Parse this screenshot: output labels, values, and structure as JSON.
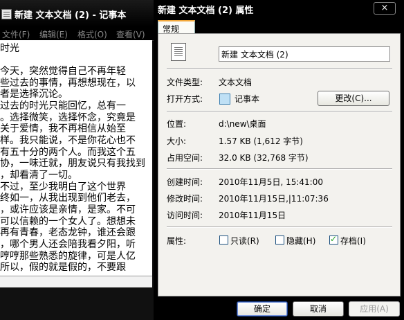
{
  "notepad": {
    "title": "新建 文本文档 (2) - 记事本",
    "menu": [
      "文件(F)",
      "编辑(E)",
      "格式(O)",
      "查看(V)"
    ],
    "lines": [
      "时光",
      "",
      "    今天，突然觉得自己不再年轻",
      "些过去的事情，再想想现在，以",
      "者是选择沉论。",
      "    过去的时光只能回忆，总有一",
      "。选择微笑，选择怀念，究竟是",
      "    关于爱情，我不再相信从始至",
      "样。我只能说，不是你花心也不",
      "有五十分的两个人。而我这个五",
      "协，一味迁就，朋友说只有我找到",
      "，却看清了一切。",
      "    不过，至少我明白了这个世界",
      "终如一，从我出现到他们老去，",
      "，或许应该是亲情，是家。不可",
      "可以信赖的一个女人了。想想未",
      "再有青春，老态龙钟，谁还会跟",
      "，哪个男人还会陪我看夕阳，听",
      "哼哼那些熟悉的旋律，可是人亿",
      "    所以，假的就是假的，不要跟"
    ]
  },
  "dialog": {
    "title": "新建 文本文档 (2) 属性",
    "close": "×",
    "tab": "常规",
    "filename": "新建 文本文档 (2)",
    "file_type_label": "文件类型:",
    "file_type": "文本文档",
    "open_with_label": "打开方式:",
    "open_with": "记事本",
    "change_button": "更改(C)...",
    "location_label": "位置:",
    "location": "d:\\new\\桌面",
    "size_label": "大小:",
    "size": "1.57 KB (1,612 字节)",
    "size_on_disk_label": "占用空间:",
    "size_on_disk": "32.0 KB (32,768 字节)",
    "created_label": "创建时间:",
    "created": "2010年11月5日, 15:41:00",
    "modified_label": "修改时间:",
    "modified": "2010年11月15日,|11:07:36",
    "accessed_label": "访问时间:",
    "accessed": "2010年11月15日",
    "attributes_label": "属性:",
    "readonly": "只读(R)",
    "hidden": "隐藏(H)",
    "archive": "存档(I)",
    "archive_checked": true,
    "ok": "确定",
    "cancel": "取消",
    "apply": "应用(A)"
  }
}
